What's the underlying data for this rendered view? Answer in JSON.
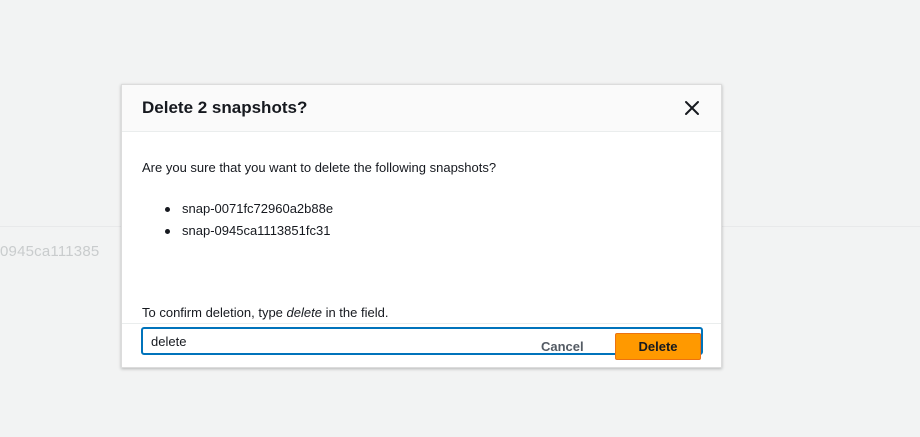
{
  "background": {
    "partial_text": "0945ca111385"
  },
  "modal": {
    "title": "Delete 2 snapshots?",
    "question": "Are you sure that you want to delete the following snapshots?",
    "snapshots": [
      "snap-0071fc72960a2b88e",
      "snap-0945ca1113851fc31"
    ],
    "confirm_prefix": "To confirm deletion, type ",
    "confirm_keyword": "delete",
    "confirm_suffix": " in the field.",
    "input_value": "delete",
    "close_icon": "close-icon"
  },
  "footer": {
    "cancel_label": "Cancel",
    "delete_label": "Delete"
  },
  "colors": {
    "accent": "#ff9900",
    "focus": "#0073bb"
  }
}
